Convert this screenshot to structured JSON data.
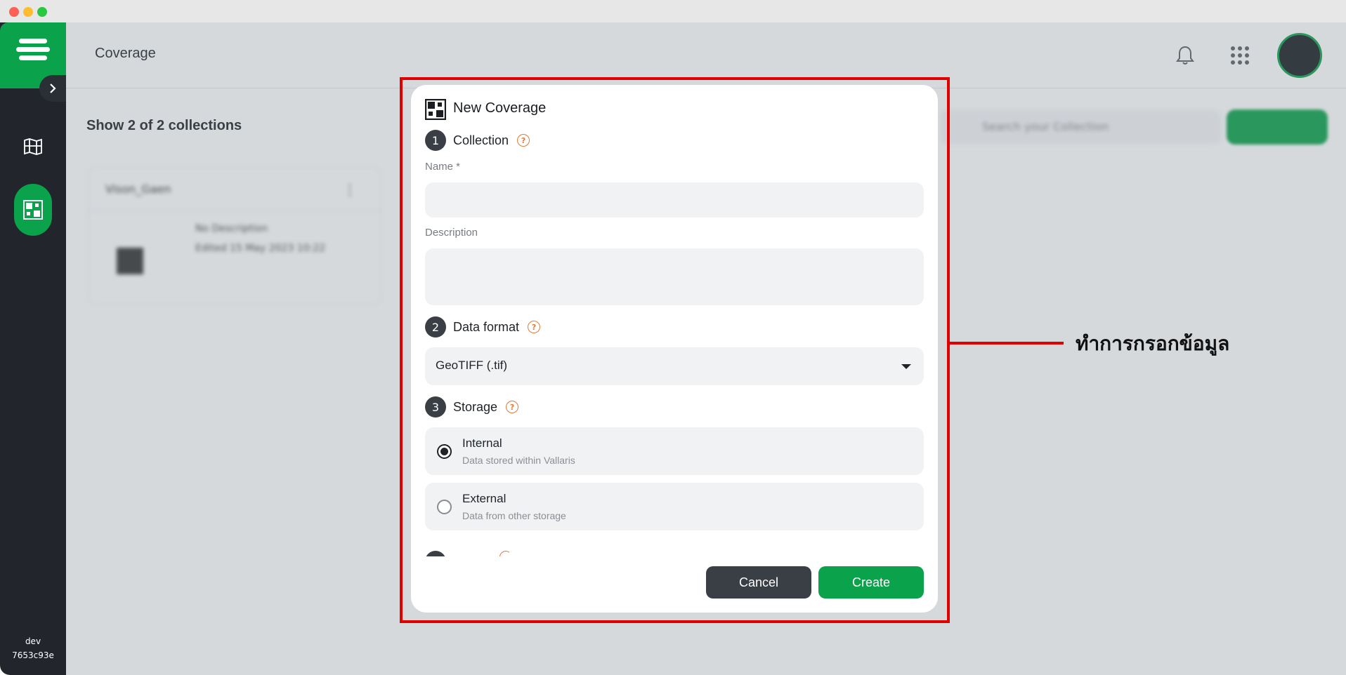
{
  "window": {
    "controls": [
      "close",
      "minimize",
      "maximize"
    ]
  },
  "sidebar": {
    "logo_icon": "layers-logo-icon",
    "expand_icon": "chevron-right-icon",
    "items": [
      {
        "icon": "map-icon",
        "active": false
      },
      {
        "icon": "coverage-grid-icon",
        "active": true
      }
    ],
    "env": "dev",
    "build": "7653c93e"
  },
  "header": {
    "title": "Coverage",
    "bell_icon": "bell-icon",
    "apps_icon": "apps-grid-icon"
  },
  "main": {
    "count_label": "Show 2 of 2 collections",
    "card": {
      "title": "Vison_Gaen",
      "description": "No Description",
      "edited": "Edited 15 May 2023 10:22"
    },
    "search_placeholder": "Search your Collection"
  },
  "modal": {
    "title": "New Coverage",
    "steps": [
      {
        "num": "1",
        "label": "Collection"
      },
      {
        "num": "2",
        "label": "Data format"
      },
      {
        "num": "3",
        "label": "Storage"
      }
    ],
    "name_label": "Name *",
    "description_label": "Description",
    "name_value": "",
    "description_value": "",
    "format_value": "GeoTIFF (.tif)",
    "storage_options": [
      {
        "title": "Internal",
        "subtitle": "Data stored within Vallaris",
        "selected": true
      },
      {
        "title": "External",
        "subtitle": "Data from other storage",
        "selected": false
      }
    ],
    "cancel_label": "Cancel",
    "create_label": "Create"
  },
  "annotation": {
    "text": "ทำการกรอกข้อมูล",
    "color": "#e10000"
  },
  "colors": {
    "brand_green": "#0aa24a",
    "sidebar_dark": "#22262c",
    "help_orange": "#e07b39"
  }
}
